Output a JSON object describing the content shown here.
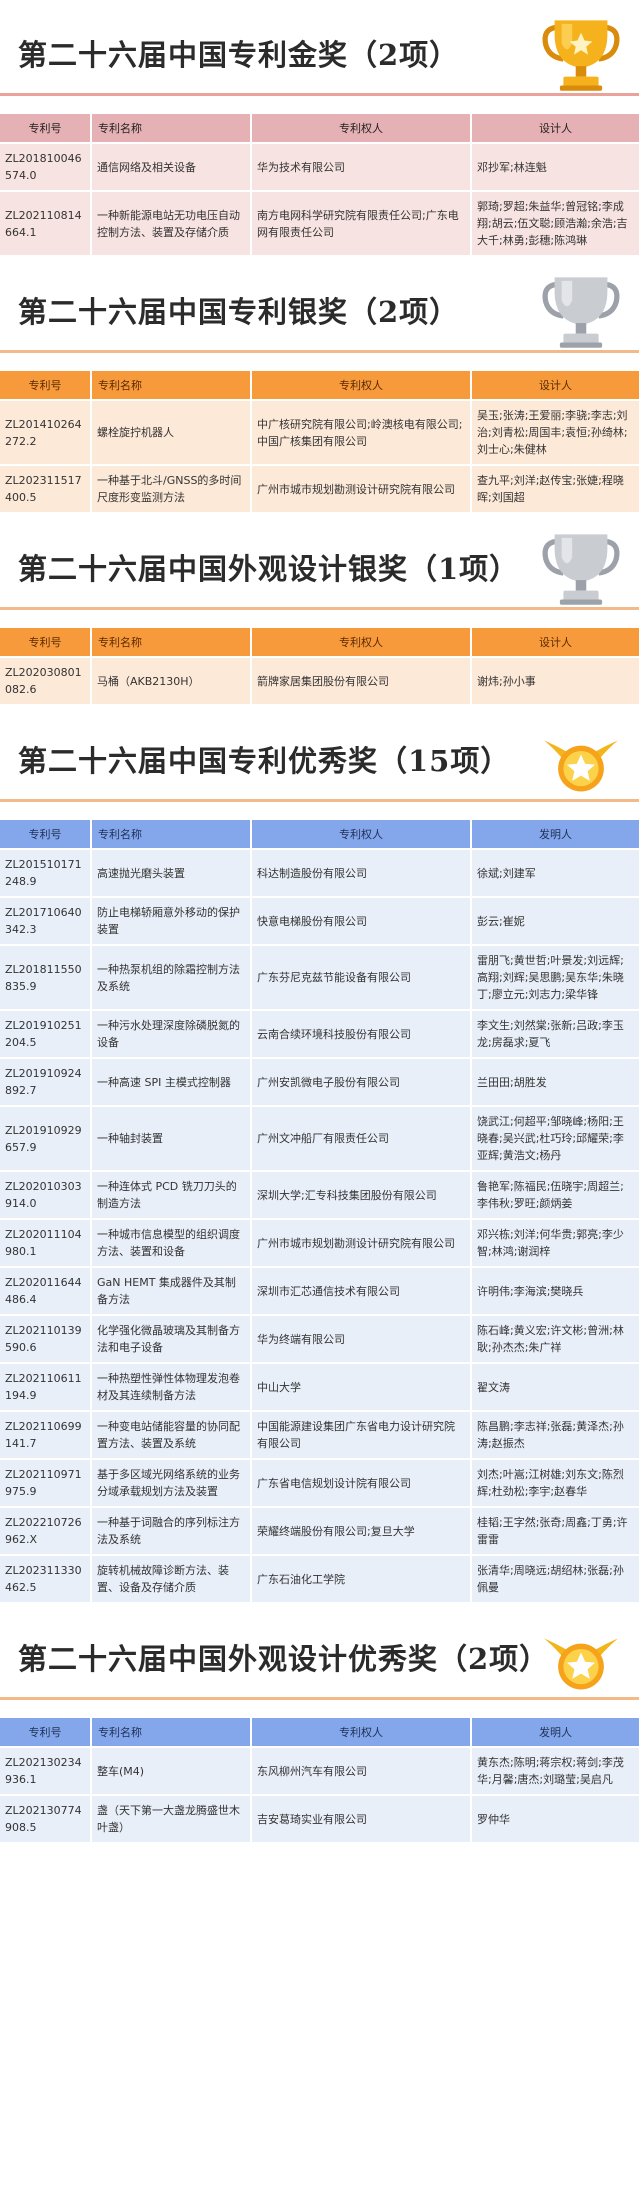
{
  "sections": [
    {
      "title": "第二十六届中国专利金奖（2项）",
      "theme": "gold",
      "icon": "gold-trophy",
      "headers": [
        "专利号",
        "专利名称",
        "专利权人",
        "设计人"
      ],
      "rows": [
        [
          "ZL201810046574.0",
          "通信网络及相关设备",
          "华为技术有限公司",
          "邓抄军;林连魁"
        ],
        [
          "ZL202110814664.1",
          "一种新能源电站无功电压自动控制方法、装置及存储介质",
          "南方电网科学研究院有限责任公司;广东电网有限责任公司",
          "郭琦;罗超;朱益华;曾冠铭;李成翔;胡云;伍文聪;顾浩瀚;余浩;吉大千;林勇;彭穗;陈鸿琳"
        ]
      ]
    },
    {
      "title": "第二十六届中国专利银奖（2项）",
      "theme": "silver",
      "icon": "silver-trophy",
      "headers": [
        "专利号",
        "专利名称",
        "专利权人",
        "设计人"
      ],
      "rows": [
        [
          "ZL201410264272.2",
          "螺栓旋拧机器人",
          "中广核研究院有限公司;岭澳核电有限公司;中国广核集团有限公司",
          "吴玉;张涛;王爱丽;李骁;李志;刘治;刘青松;周国丰;袁恒;孙绮林;刘士心;朱健林"
        ],
        [
          "ZL202311517400.5",
          "一种基于北斗/GNSS的多时间尺度形变监测方法",
          "广州市城市规划勘测设计研究院有限公司",
          "查九平;刘洋;赵传宝;张婕;程晓晖;刘国超"
        ]
      ]
    },
    {
      "title": "第二十六届中国外观设计银奖（1项）",
      "theme": "silver",
      "icon": "silver-trophy",
      "headers": [
        "专利号",
        "专利名称",
        "专利权人",
        "设计人"
      ],
      "rows": [
        [
          "ZL202030801082.6",
          "马桶（AKB2130H）",
          "箭牌家居集团股份有限公司",
          "谢炜;孙小事"
        ]
      ]
    },
    {
      "title": "第二十六届中国专利优秀奖（15项）",
      "theme": "excellent",
      "icon": "star-medal",
      "headers": [
        "专利号",
        "专利名称",
        "专利权人",
        "发明人"
      ],
      "rows": [
        [
          "ZL201510171248.9",
          "高速抛光磨头装置",
          "科达制造股份有限公司",
          "徐斌;刘建军"
        ],
        [
          "ZL201710640342.3",
          "防止电梯轿厢意外移动的保护装置",
          "快意电梯股份有限公司",
          "彭云;崔妮"
        ],
        [
          "ZL201811550835.9",
          "一种热泵机组的除霜控制方法及系统",
          "广东芬尼克兹节能设备有限公司",
          "雷朋飞;黄世哲;叶景发;刘远辉;高翔;刘辉;吴思鹏;吴东华;朱晓丁;廖立元;刘志力;梁华锋"
        ],
        [
          "ZL201910251204.5",
          "一种污水处理深度除磷脱氮的设备",
          "云南合续环境科技股份有限公司",
          "李文生;刘然棠;张新;吕政;李玉龙;房磊求;夏飞"
        ],
        [
          "ZL201910924892.7",
          "一种高速 SPI 主模式控制器",
          "广州安凯微电子股份有限公司",
          "兰田田;胡胜发"
        ],
        [
          "ZL201910929657.9",
          "一种轴封装置",
          "广州文冲船厂有限责任公司",
          "饶武江;何超平;邹晓峰;杨阳;王晓春;吴兴武;杜巧玲;邱耀荣;李亚辉;黄浩文;杨丹"
        ],
        [
          "ZL202010303914.0",
          "一种连体式 PCD 铣刀刀头的制造方法",
          "深圳大学;汇专科技集团股份有限公司",
          "鲁艳军;陈福民;伍晓宇;周超兰;李伟秋;罗旺;颜炳姜"
        ],
        [
          "ZL202011104980.1",
          "一种城市信息模型的组织调度方法、装置和设备",
          "广州市城市规划勘测设计研究院有限公司",
          "邓兴栋;刘洋;何华贵;郭亮;李少智;林鸿;谢润梓"
        ],
        [
          "ZL202011644486.4",
          "GaN HEMT 集成器件及其制备方法",
          "深圳市汇芯通信技术有限公司",
          "许明伟;李海滨;樊晓兵"
        ],
        [
          "ZL202110139590.6",
          "化学强化微晶玻璃及其制备方法和电子设备",
          "华为终端有限公司",
          "陈石峰;黄义宏;许文彬;曾洲;林耿;孙杰杰;朱广祥"
        ],
        [
          "ZL202110611194.9",
          "一种热塑性弹性体物理发泡卷材及其连续制备方法",
          "中山大学",
          "翟文涛"
        ],
        [
          "ZL202110699141.7",
          "一种变电站储能容量的协同配置方法、装置及系统",
          "中国能源建设集团广东省电力设计研究院有限公司",
          "陈昌鹏;李志祥;张磊;黄泽杰;孙涛;赵振杰"
        ],
        [
          "ZL202110971975.9",
          "基于多区域光网络系统的业务分域承载规划方法及装置",
          "广东省电信规划设计院有限公司",
          "刘杰;叶嵩;江树雄;刘东文;陈烈辉;杜劲松;李宇;赵春华"
        ],
        [
          "ZL202210726962.X",
          "一种基于词融合的序列标注方法及系统",
          "荣耀终端股份有限公司;复旦大学",
          "桂韬;王字然;张奇;周鑫;丁勇;许雷雷"
        ],
        [
          "ZL202311330462.5",
          "旋转机械故障诊断方法、装置、设备及存储介质",
          "广东石油化工学院",
          "张清华;周晓远;胡绍林;张磊;孙佩曼"
        ]
      ]
    },
    {
      "title": "第二十六届中国外观设计优秀奖（2项）",
      "theme": "excellent",
      "icon": "star-medal",
      "headers": [
        "专利号",
        "专利名称",
        "专利权人",
        "发明人"
      ],
      "rows": [
        [
          "ZL202130234936.1",
          "整车(M4)",
          "东风柳州汽车有限公司",
          "黄东杰;陈明;蒋宗权;蒋剑;李茂华;月馨;唐杰;刘璐莹;吴启凡"
        ],
        [
          "ZL202130774908.5",
          "盏（天下第一大盏龙腾盛世木叶盏）",
          "吉安葛琦实业有限公司",
          "罗仲华"
        ]
      ]
    }
  ]
}
